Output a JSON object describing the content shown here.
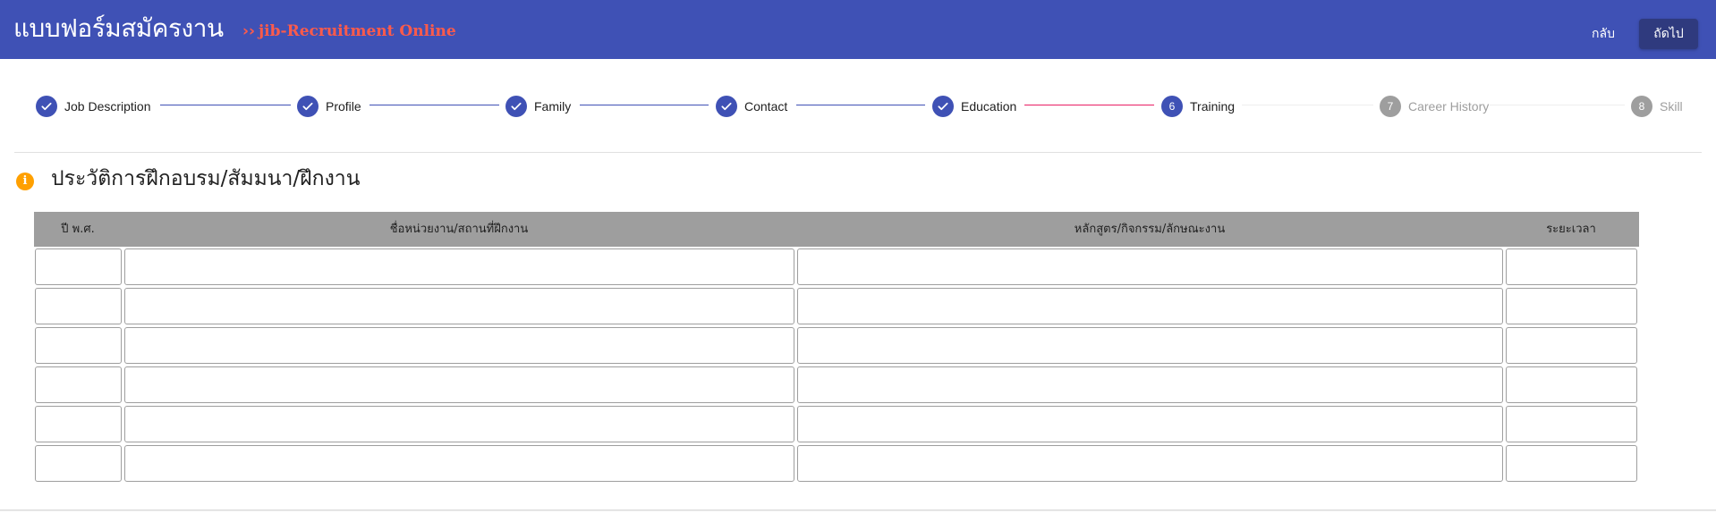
{
  "header": {
    "title": "แบบฟอร์มสมัครงาน",
    "subtitle_prefix": "››",
    "subtitle": "jib-Recruitment Online",
    "back_label": "กลับ",
    "next_label": "ถัดไป",
    "bg_color": "#3f51b5",
    "subtitle_color": "#ff5b4a"
  },
  "stepper": {
    "steps": [
      {
        "label": "Job Description",
        "state": "done",
        "icon": "check-icon"
      },
      {
        "label": "Profile",
        "state": "done",
        "icon": "check-icon"
      },
      {
        "label": "Family",
        "state": "done",
        "icon": "check-icon"
      },
      {
        "label": "Contact",
        "state": "done",
        "icon": "check-icon"
      },
      {
        "label": "Education",
        "state": "done",
        "icon": "check-icon"
      },
      {
        "label": "Training",
        "state": "active",
        "number": "6"
      },
      {
        "label": "Career History",
        "state": "pending",
        "number": "7"
      },
      {
        "label": "Skill",
        "state": "pending",
        "number": "8"
      }
    ],
    "active_color": "#3f51b5",
    "active_line_color": "#e91e63",
    "pending_color": "#9e9e9e"
  },
  "section": {
    "icon": "info-icon",
    "icon_glyph": "i",
    "title": "ประวัติการฝึกอบรม/สัมมนา/ฝึกงาน"
  },
  "table": {
    "headers": [
      "ปี พ.ศ.",
      "ชื่อหน่วยงาน/สถานที่ฝึกงาน",
      "หลักสูตร/กิจกรรม/ลักษณะงาน",
      "ระยะเวลา"
    ],
    "rows": [
      [
        "",
        "",
        "",
        ""
      ],
      [
        "",
        "",
        "",
        ""
      ],
      [
        "",
        "",
        "",
        ""
      ],
      [
        "",
        "",
        "",
        ""
      ],
      [
        "",
        "",
        "",
        ""
      ],
      [
        "",
        "",
        "",
        ""
      ]
    ]
  }
}
